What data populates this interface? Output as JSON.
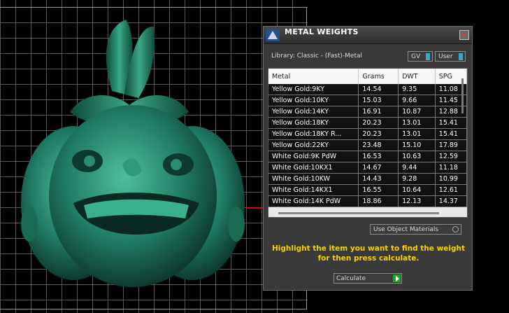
{
  "window": {
    "title": "METAL WEIGHTS",
    "close_label": "×",
    "library_label": "Library: Classic - (Fast)-Metal",
    "toggles": [
      {
        "label": "GV"
      },
      {
        "label": "User"
      }
    ]
  },
  "table": {
    "headers": [
      "Metal",
      "Grams",
      "DWT",
      "SPG"
    ],
    "rows": [
      {
        "metal": "Yellow Gold:9KY",
        "grams": "14.54",
        "dwt": "9.35",
        "spg": "11.08"
      },
      {
        "metal": "Yellow Gold:10KY",
        "grams": "15.03",
        "dwt": "9.66",
        "spg": "11.45"
      },
      {
        "metal": "Yellow Gold:14KY",
        "grams": "16.91",
        "dwt": "10.87",
        "spg": "12.88"
      },
      {
        "metal": "Yellow Gold:18KY",
        "grams": "20.23",
        "dwt": "13.01",
        "spg": "15.41"
      },
      {
        "metal": "Yellow Gold:18KY R...",
        "grams": "20.23",
        "dwt": "13.01",
        "spg": "15.41"
      },
      {
        "metal": "Yellow Gold:22KY",
        "grams": "23.48",
        "dwt": "15.10",
        "spg": "17.89"
      },
      {
        "metal": "White Gold:9K PdW",
        "grams": "16.53",
        "dwt": "10.63",
        "spg": "12.59"
      },
      {
        "metal": "White Gold:10KX1",
        "grams": "14.67",
        "dwt": "9.44",
        "spg": "11.18"
      },
      {
        "metal": "White Gold:10KW",
        "grams": "14.43",
        "dwt": "9.28",
        "spg": "10.99"
      },
      {
        "metal": "White Gold:14KX1",
        "grams": "16.55",
        "dwt": "10.64",
        "spg": "12.61"
      },
      {
        "metal": "White Gold:14K PdW",
        "grams": "18.86",
        "dwt": "12.13",
        "spg": "14.37"
      }
    ]
  },
  "materials_dropdown": {
    "label": "Use Object Materials"
  },
  "instruction": "Highlight the item you want to find the weight for then press calculate.",
  "calculate_dropdown": {
    "label": "Calculate"
  },
  "colors": {
    "model": "#1f7a63",
    "instruction": "#f5d200",
    "toggle_accent": "#3aa7c7"
  }
}
